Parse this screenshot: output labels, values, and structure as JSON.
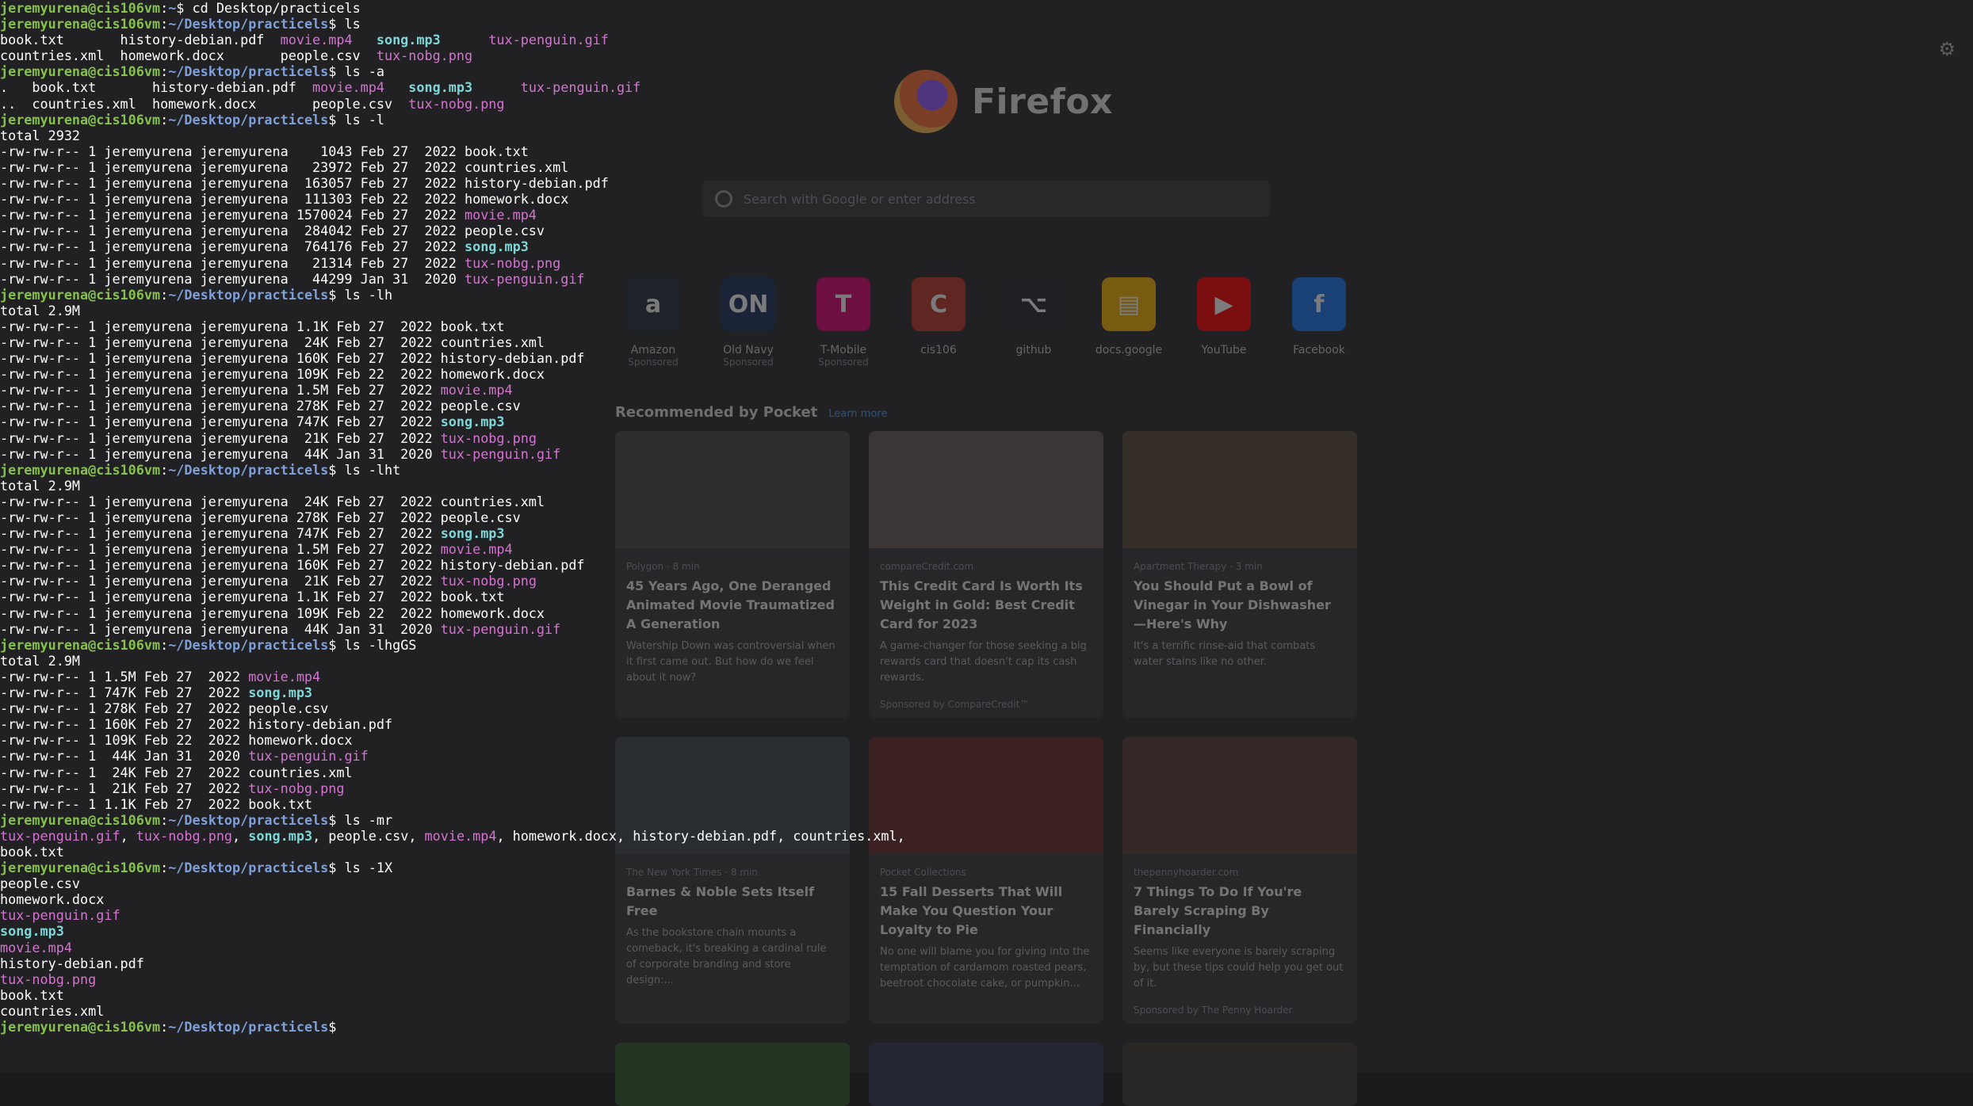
{
  "terminal": {
    "user_host": "jeremyurena@cis106vm",
    "lines": [
      {
        "kind": "prompt",
        "path": "~",
        "cmd": "cd Desktop/practicels"
      },
      {
        "kind": "prompt",
        "path": "~/Desktop/practicels",
        "cmd": "ls"
      },
      {
        "kind": "out",
        "segs": [
          {
            "t": "book.txt       history-debian.pdf  ",
            "c": "plain"
          },
          {
            "t": "movie.mp4",
            "c": "media"
          },
          {
            "t": "   ",
            "c": "plain"
          },
          {
            "t": "song.mp3",
            "c": "audio"
          },
          {
            "t": "      ",
            "c": "plain"
          },
          {
            "t": "tux-penguin.gif",
            "c": "media"
          }
        ]
      },
      {
        "kind": "out",
        "segs": [
          {
            "t": "countries.xml  homework.docx       people.csv  ",
            "c": "plain"
          },
          {
            "t": "tux-nobg.png",
            "c": "media"
          }
        ]
      },
      {
        "kind": "prompt",
        "path": "~/Desktop/practicels",
        "cmd": "ls -a"
      },
      {
        "kind": "out",
        "segs": [
          {
            "t": ".   book.txt       history-debian.pdf  ",
            "c": "plain"
          },
          {
            "t": "movie.mp4",
            "c": "media"
          },
          {
            "t": "   ",
            "c": "plain"
          },
          {
            "t": "song.mp3",
            "c": "audio"
          },
          {
            "t": "      ",
            "c": "plain"
          },
          {
            "t": "tux-penguin.gif",
            "c": "media"
          }
        ]
      },
      {
        "kind": "out",
        "segs": [
          {
            "t": "..  countries.xml  homework.docx       people.csv  ",
            "c": "plain"
          },
          {
            "t": "tux-nobg.png",
            "c": "media"
          }
        ]
      },
      {
        "kind": "prompt",
        "path": "~/Desktop/practicels",
        "cmd": "ls -l"
      },
      {
        "kind": "out",
        "segs": [
          {
            "t": "total 2932",
            "c": "plain"
          }
        ]
      },
      {
        "kind": "out",
        "segs": [
          {
            "t": "-rw-rw-r-- 1 jeremyurena jeremyurena    1043 Feb 27  2022 book.txt",
            "c": "plain"
          }
        ]
      },
      {
        "kind": "out",
        "segs": [
          {
            "t": "-rw-rw-r-- 1 jeremyurena jeremyurena   23972 Feb 27  2022 countries.xml",
            "c": "plain"
          }
        ]
      },
      {
        "kind": "out",
        "segs": [
          {
            "t": "-rw-rw-r-- 1 jeremyurena jeremyurena  163057 Feb 27  2022 history-debian.pdf",
            "c": "plain"
          }
        ]
      },
      {
        "kind": "out",
        "segs": [
          {
            "t": "-rw-rw-r-- 1 jeremyurena jeremyurena  111303 Feb 22  2022 homework.docx",
            "c": "plain"
          }
        ]
      },
      {
        "kind": "out",
        "segs": [
          {
            "t": "-rw-rw-r-- 1 jeremyurena jeremyurena 1570024 Feb 27  2022 ",
            "c": "plain"
          },
          {
            "t": "movie.mp4",
            "c": "media"
          }
        ]
      },
      {
        "kind": "out",
        "segs": [
          {
            "t": "-rw-rw-r-- 1 jeremyurena jeremyurena  284042 Feb 27  2022 people.csv",
            "c": "plain"
          }
        ]
      },
      {
        "kind": "out",
        "segs": [
          {
            "t": "-rw-rw-r-- 1 jeremyurena jeremyurena  764176 Feb 27  2022 ",
            "c": "plain"
          },
          {
            "t": "song.mp3",
            "c": "audio"
          }
        ]
      },
      {
        "kind": "out",
        "segs": [
          {
            "t": "-rw-rw-r-- 1 jeremyurena jeremyurena   21314 Feb 27  2022 ",
            "c": "plain"
          },
          {
            "t": "tux-nobg.png",
            "c": "media"
          }
        ]
      },
      {
        "kind": "out",
        "segs": [
          {
            "t": "-rw-rw-r-- 1 jeremyurena jeremyurena   44299 Jan 31  2020 ",
            "c": "plain"
          },
          {
            "t": "tux-penguin.gif",
            "c": "media"
          }
        ]
      },
      {
        "kind": "prompt",
        "path": "~/Desktop/practicels",
        "cmd": "ls -lh"
      },
      {
        "kind": "out",
        "segs": [
          {
            "t": "total 2.9M",
            "c": "plain"
          }
        ]
      },
      {
        "kind": "out",
        "segs": [
          {
            "t": "-rw-rw-r-- 1 jeremyurena jeremyurena 1.1K Feb 27  2022 book.txt",
            "c": "plain"
          }
        ]
      },
      {
        "kind": "out",
        "segs": [
          {
            "t": "-rw-rw-r-- 1 jeremyurena jeremyurena  24K Feb 27  2022 countries.xml",
            "c": "plain"
          }
        ]
      },
      {
        "kind": "out",
        "segs": [
          {
            "t": "-rw-rw-r-- 1 jeremyurena jeremyurena 160K Feb 27  2022 history-debian.pdf",
            "c": "plain"
          }
        ]
      },
      {
        "kind": "out",
        "segs": [
          {
            "t": "-rw-rw-r-- 1 jeremyurena jeremyurena 109K Feb 22  2022 homework.docx",
            "c": "plain"
          }
        ]
      },
      {
        "kind": "out",
        "segs": [
          {
            "t": "-rw-rw-r-- 1 jeremyurena jeremyurena 1.5M Feb 27  2022 ",
            "c": "plain"
          },
          {
            "t": "movie.mp4",
            "c": "media"
          }
        ]
      },
      {
        "kind": "out",
        "segs": [
          {
            "t": "-rw-rw-r-- 1 jeremyurena jeremyurena 278K Feb 27  2022 people.csv",
            "c": "plain"
          }
        ]
      },
      {
        "kind": "out",
        "segs": [
          {
            "t": "-rw-rw-r-- 1 jeremyurena jeremyurena 747K Feb 27  2022 ",
            "c": "plain"
          },
          {
            "t": "song.mp3",
            "c": "audio"
          }
        ]
      },
      {
        "kind": "out",
        "segs": [
          {
            "t": "-rw-rw-r-- 1 jeremyurena jeremyurena  21K Feb 27  2022 ",
            "c": "plain"
          },
          {
            "t": "tux-nobg.png",
            "c": "media"
          }
        ]
      },
      {
        "kind": "out",
        "segs": [
          {
            "t": "-rw-rw-r-- 1 jeremyurena jeremyurena  44K Jan 31  2020 ",
            "c": "plain"
          },
          {
            "t": "tux-penguin.gif",
            "c": "media"
          }
        ]
      },
      {
        "kind": "prompt",
        "path": "~/Desktop/practicels",
        "cmd": "ls -lht"
      },
      {
        "kind": "out",
        "segs": [
          {
            "t": "total 2.9M",
            "c": "plain"
          }
        ]
      },
      {
        "kind": "out",
        "segs": [
          {
            "t": "-rw-rw-r-- 1 jeremyurena jeremyurena  24K Feb 27  2022 countries.xml",
            "c": "plain"
          }
        ]
      },
      {
        "kind": "out",
        "segs": [
          {
            "t": "-rw-rw-r-- 1 jeremyurena jeremyurena 278K Feb 27  2022 people.csv",
            "c": "plain"
          }
        ]
      },
      {
        "kind": "out",
        "segs": [
          {
            "t": "-rw-rw-r-- 1 jeremyurena jeremyurena 747K Feb 27  2022 ",
            "c": "plain"
          },
          {
            "t": "song.mp3",
            "c": "audio"
          }
        ]
      },
      {
        "kind": "out",
        "segs": [
          {
            "t": "-rw-rw-r-- 1 jeremyurena jeremyurena 1.5M Feb 27  2022 ",
            "c": "plain"
          },
          {
            "t": "movie.mp4",
            "c": "media"
          }
        ]
      },
      {
        "kind": "out",
        "segs": [
          {
            "t": "-rw-rw-r-- 1 jeremyurena jeremyurena 160K Feb 27  2022 history-debian.pdf",
            "c": "plain"
          }
        ]
      },
      {
        "kind": "out",
        "segs": [
          {
            "t": "-rw-rw-r-- 1 jeremyurena jeremyurena  21K Feb 27  2022 ",
            "c": "plain"
          },
          {
            "t": "tux-nobg.png",
            "c": "media"
          }
        ]
      },
      {
        "kind": "out",
        "segs": [
          {
            "t": "-rw-rw-r-- 1 jeremyurena jeremyurena 1.1K Feb 27  2022 book.txt",
            "c": "plain"
          }
        ]
      },
      {
        "kind": "out",
        "segs": [
          {
            "t": "-rw-rw-r-- 1 jeremyurena jeremyurena 109K Feb 22  2022 homework.docx",
            "c": "plain"
          }
        ]
      },
      {
        "kind": "out",
        "segs": [
          {
            "t": "-rw-rw-r-- 1 jeremyurena jeremyurena  44K Jan 31  2020 ",
            "c": "plain"
          },
          {
            "t": "tux-penguin.gif",
            "c": "media"
          }
        ]
      },
      {
        "kind": "prompt",
        "path": "~/Desktop/practicels",
        "cmd": "ls -lhgGS"
      },
      {
        "kind": "out",
        "segs": [
          {
            "t": "total 2.9M",
            "c": "plain"
          }
        ]
      },
      {
        "kind": "out",
        "segs": [
          {
            "t": "-rw-rw-r-- 1 1.5M Feb 27  2022 ",
            "c": "plain"
          },
          {
            "t": "movie.mp4",
            "c": "media"
          }
        ]
      },
      {
        "kind": "out",
        "segs": [
          {
            "t": "-rw-rw-r-- 1 747K Feb 27  2022 ",
            "c": "plain"
          },
          {
            "t": "song.mp3",
            "c": "audio"
          }
        ]
      },
      {
        "kind": "out",
        "segs": [
          {
            "t": "-rw-rw-r-- 1 278K Feb 27  2022 people.csv",
            "c": "plain"
          }
        ]
      },
      {
        "kind": "out",
        "segs": [
          {
            "t": "-rw-rw-r-- 1 160K Feb 27  2022 history-debian.pdf",
            "c": "plain"
          }
        ]
      },
      {
        "kind": "out",
        "segs": [
          {
            "t": "-rw-rw-r-- 1 109K Feb 22  2022 homework.docx",
            "c": "plain"
          }
        ]
      },
      {
        "kind": "out",
        "segs": [
          {
            "t": "-rw-rw-r-- 1  44K Jan 31  2020 ",
            "c": "plain"
          },
          {
            "t": "tux-penguin.gif",
            "c": "media"
          }
        ]
      },
      {
        "kind": "out",
        "segs": [
          {
            "t": "-rw-rw-r-- 1  24K Feb 27  2022 countries.xml",
            "c": "plain"
          }
        ]
      },
      {
        "kind": "out",
        "segs": [
          {
            "t": "-rw-rw-r-- 1  21K Feb 27  2022 ",
            "c": "plain"
          },
          {
            "t": "tux-nobg.png",
            "c": "media"
          }
        ]
      },
      {
        "kind": "out",
        "segs": [
          {
            "t": "-rw-rw-r-- 1 1.1K Feb 27  2022 book.txt",
            "c": "plain"
          }
        ]
      },
      {
        "kind": "prompt",
        "path": "~/Desktop/practicels",
        "cmd": "ls -mr"
      },
      {
        "kind": "out",
        "segs": [
          {
            "t": "tux-penguin.gif",
            "c": "media"
          },
          {
            "t": ", ",
            "c": "plain"
          },
          {
            "t": "tux-nobg.png",
            "c": "media"
          },
          {
            "t": ", ",
            "c": "plain"
          },
          {
            "t": "song.mp3",
            "c": "audio"
          },
          {
            "t": ", people.csv, ",
            "c": "plain"
          },
          {
            "t": "movie.mp4",
            "c": "media"
          },
          {
            "t": ", homework.docx, history-debian.pdf, countries.xml,",
            "c": "plain"
          }
        ]
      },
      {
        "kind": "out",
        "segs": [
          {
            "t": "book.txt",
            "c": "plain"
          }
        ]
      },
      {
        "kind": "prompt",
        "path": "~/Desktop/practicels",
        "cmd": "ls -1X"
      },
      {
        "kind": "out",
        "segs": [
          {
            "t": "people.csv",
            "c": "plain"
          }
        ]
      },
      {
        "kind": "out",
        "segs": [
          {
            "t": "homework.docx",
            "c": "plain"
          }
        ]
      },
      {
        "kind": "out",
        "segs": [
          {
            "t": "tux-penguin.gif",
            "c": "media"
          }
        ]
      },
      {
        "kind": "out",
        "segs": [
          {
            "t": "song.mp3",
            "c": "audio"
          }
        ]
      },
      {
        "kind": "out",
        "segs": [
          {
            "t": "movie.mp4",
            "c": "media"
          }
        ]
      },
      {
        "kind": "out",
        "segs": [
          {
            "t": "history-debian.pdf",
            "c": "plain"
          }
        ]
      },
      {
        "kind": "out",
        "segs": [
          {
            "t": "tux-nobg.png",
            "c": "media"
          }
        ]
      },
      {
        "kind": "out",
        "segs": [
          {
            "t": "book.txt",
            "c": "plain"
          }
        ]
      },
      {
        "kind": "out",
        "segs": [
          {
            "t": "countries.xml",
            "c": "plain"
          }
        ]
      },
      {
        "kind": "prompt",
        "path": "~/Desktop/practicels",
        "cmd": ""
      }
    ]
  },
  "colors": {
    "prompt_user": "#86c14d",
    "prompt_path": "#7f9fd9",
    "media_file": "#d374d0",
    "audio_file": "#7ed7d7",
    "text": "#ffffff"
  },
  "firefox": {
    "brand": "Firefox",
    "search_placeholder": "Search with Google or enter address",
    "shortcuts": [
      {
        "label": "Amazon",
        "sub": "Sponsored",
        "glyph": "a",
        "icon": "amazon-icon",
        "color": "#232f3e"
      },
      {
        "label": "Old Navy",
        "sub": "Sponsored",
        "glyph": "ON",
        "icon": "old-navy-icon",
        "color": "#1b2f5e"
      },
      {
        "label": "T-Mobile",
        "sub": "Sponsored",
        "glyph": "T",
        "icon": "tmobile-icon",
        "color": "#e20074"
      },
      {
        "label": "cis106",
        "sub": "",
        "glyph": "C",
        "icon": "cis106-icon",
        "color": "#c0392b"
      },
      {
        "label": "github",
        "sub": "",
        "glyph": "⌥",
        "icon": "github-icon",
        "color": "#24292e"
      },
      {
        "label": "docs.google",
        "sub": "",
        "glyph": "▤",
        "icon": "google-docs-icon",
        "color": "#f4b400"
      },
      {
        "label": "YouTube",
        "sub": "",
        "glyph": "▶",
        "icon": "youtube-icon",
        "color": "#ff0000"
      },
      {
        "label": "Facebook",
        "sub": "",
        "glyph": "f",
        "icon": "facebook-icon",
        "color": "#1877f2"
      }
    ],
    "pocket_heading": "Recommended by Pocket",
    "pocket_learn_more": "Learn more",
    "cards": [
      {
        "source": "Polygon · 8 min",
        "title": "45 Years Ago, One Deranged Animated Movie Traumatized A Generation",
        "desc": "Watership Down was controversial when it first came out. But how do we feel about it now?",
        "sponsor": "",
        "img": "#4a4a4a"
      },
      {
        "source": "compareCredit.com",
        "title": "This Credit Card Is Worth Its Weight in Gold: Best Credit Card for 2023",
        "desc": "A game-changer for those seeking a big rewards card that doesn't cap its cash rewards.",
        "sponsor": "Sponsored by CompareCredit™",
        "img": "#6b5a58"
      },
      {
        "source": "Apartment Therapy · 3 min",
        "title": "You Should Put a Bowl of Vinegar in Your Dishwasher —Here's Why",
        "desc": "It's a terrific rinse-aid that combats water stains like no other.",
        "sponsor": "",
        "img": "#5b4c3a"
      },
      {
        "source": "The New York Times · 8 min",
        "title": "Barnes & Noble Sets Itself Free",
        "desc": "As the bookstore chain mounts a comeback, it's breaking a cardinal rule of corporate branding and store design:...",
        "sponsor": "",
        "img": "#3f4a52"
      },
      {
        "source": "Pocket Collections",
        "title": "15 Fall Desserts That Will Make You Question Your Loyalty to Pie",
        "desc": "No one will blame you for giving into the temptation of cardamom roasted pears, beetroot chocolate cake, or pumpkin...",
        "sponsor": "",
        "img": "#6a2a2a"
      },
      {
        "source": "thepennyhoarder.com",
        "title": "7 Things To Do If You're Barely Scraping By Financially",
        "desc": "Seems like everyone is barely scraping by, but these tips could help you get out of it.",
        "sponsor": "Sponsored by The Penny Hoarder",
        "img": "#5a3e36"
      },
      {
        "source": "",
        "title": "",
        "desc": "",
        "sponsor": "",
        "img": "#2f5a2a"
      },
      {
        "source": "",
        "title": "",
        "desc": "",
        "sponsor": "",
        "img": "#2e3350"
      },
      {
        "source": "",
        "title": "",
        "desc": "",
        "sponsor": "",
        "img": "#3a3530"
      }
    ]
  }
}
